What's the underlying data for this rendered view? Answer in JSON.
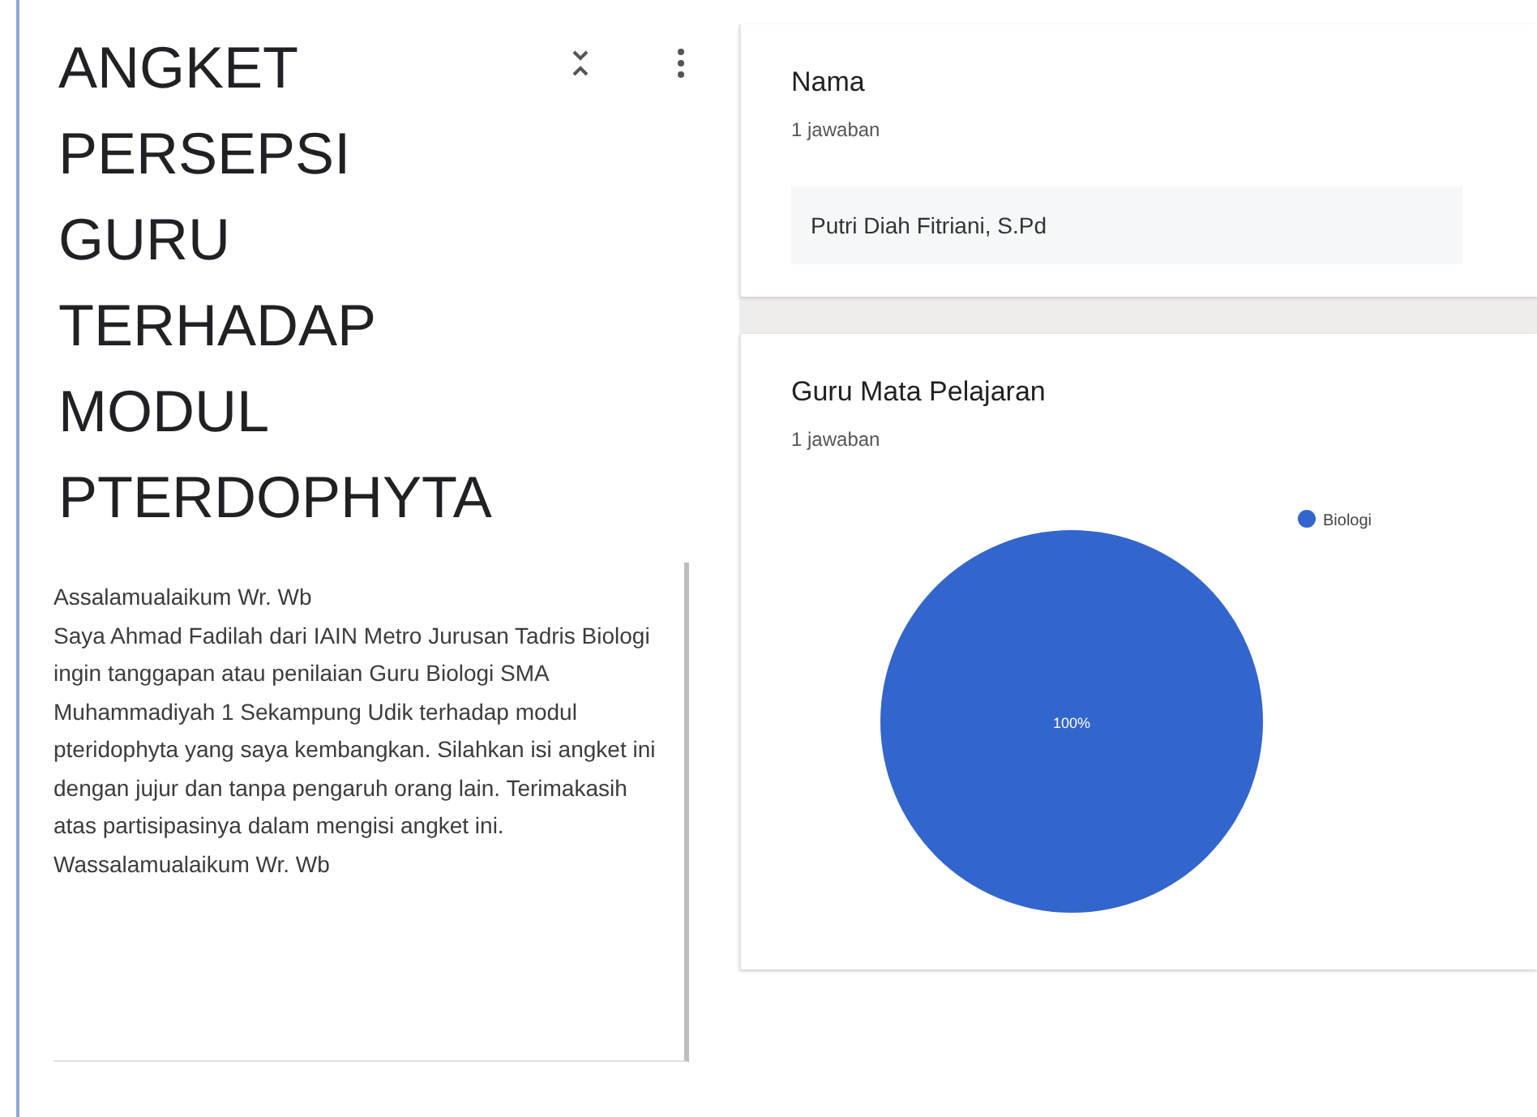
{
  "form": {
    "title": "ANGKET PERSEPSI GURU TERHADAP MODUL PTERDOPHYTA",
    "description": "Assalamualaikum Wr. Wb\nSaya Ahmad Fadilah dari IAIN Metro Jurusan Tadris Biologi ingin tanggapan atau penilaian Guru Biologi SMA Muhammadiyah 1 Sekampung Udik terhadap modul pteridophyta yang saya kembangkan. Silahkan isi angket ini dengan jujur dan tanpa pengaruh orang lain. Terimakasih atas partisipasinya dalam mengisi angket ini.\nWassalamualaikum Wr. Wb"
  },
  "questions": [
    {
      "kind": "text",
      "title": "Nama",
      "count": "1 jawaban",
      "answers": [
        "Putri Diah Fitriani, S.Pd"
      ]
    },
    {
      "kind": "pie",
      "title": "Guru Mata Pelajaran",
      "count": "1 jawaban",
      "chart_data": {
        "type": "pie",
        "series": [
          {
            "name": "Biologi",
            "color": "#3366cc",
            "values": [
              100
            ]
          }
        ],
        "value_labels": [
          "100%"
        ]
      }
    }
  ]
}
